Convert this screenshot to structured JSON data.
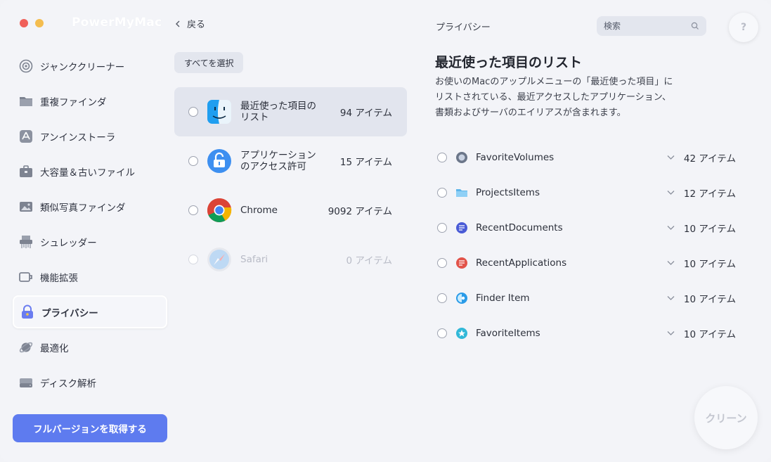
{
  "app": {
    "title": "PowerMyMac"
  },
  "header": {
    "back_label": "戻る",
    "section_label": "プライバシー",
    "search_placeholder": "検索",
    "help_label": "?"
  },
  "sidebar": {
    "items": [
      {
        "label": "ジャンククリーナー",
        "icon": "target-icon"
      },
      {
        "label": "重複ファインダ",
        "icon": "folder-icon"
      },
      {
        "label": "アンインストーラ",
        "icon": "app-store-icon"
      },
      {
        "label": "大容量＆古いファイル",
        "icon": "briefcase-icon"
      },
      {
        "label": "類似写真ファインダ",
        "icon": "photo-icon"
      },
      {
        "label": "シュレッダー",
        "icon": "shredder-icon"
      },
      {
        "label": "機能拡張",
        "icon": "extension-icon"
      },
      {
        "label": "プライバシー",
        "icon": "lock-icon",
        "active": true
      },
      {
        "label": "最適化",
        "icon": "planet-icon"
      },
      {
        "label": "ディスク解析",
        "icon": "disk-icon"
      }
    ],
    "upgrade_label": "フルバージョンを取得する"
  },
  "middle": {
    "select_all_label": "すべてを選択",
    "apps": [
      {
        "name": "最近使った項目のリスト",
        "count": "94 アイテム",
        "icon": "finder-icon",
        "selected": true
      },
      {
        "name": "アプリケーションのアクセス許可",
        "count": "15 アイテム",
        "icon": "unlock-icon"
      },
      {
        "name": "Chrome",
        "count": "9092 アイテム",
        "icon": "chrome-icon"
      },
      {
        "name": "Safari",
        "count": "0 アイテム",
        "icon": "safari-icon",
        "disabled": true
      }
    ]
  },
  "detail": {
    "title": "最近使った項目のリスト",
    "description": "お使いのMacのアップルメニューの「最近使った項目」にリストされている、最近アクセスしたアプリケーション、書類およびサーバのエイリアスが含まれます。",
    "items": [
      {
        "name": "FavoriteVolumes",
        "count": "42 アイテム",
        "icon": "disk-volume-icon"
      },
      {
        "name": "ProjectsItems",
        "count": "12 アイテム",
        "icon": "folder-icon"
      },
      {
        "name": "RecentDocuments",
        "count": "10 アイテム",
        "icon": "document-icon"
      },
      {
        "name": "RecentApplications",
        "count": "10 アイテム",
        "icon": "application-icon"
      },
      {
        "name": "Finder Item",
        "count": "10 アイテム",
        "icon": "finder-item-icon"
      },
      {
        "name": "FavoriteItems",
        "count": "10 アイテム",
        "icon": "star-icon"
      }
    ],
    "clean_label": "クリーン"
  },
  "colors": {
    "accent": "#5e7bef",
    "background": "#f3f4f8",
    "selected_row": "#e2e5ee"
  }
}
